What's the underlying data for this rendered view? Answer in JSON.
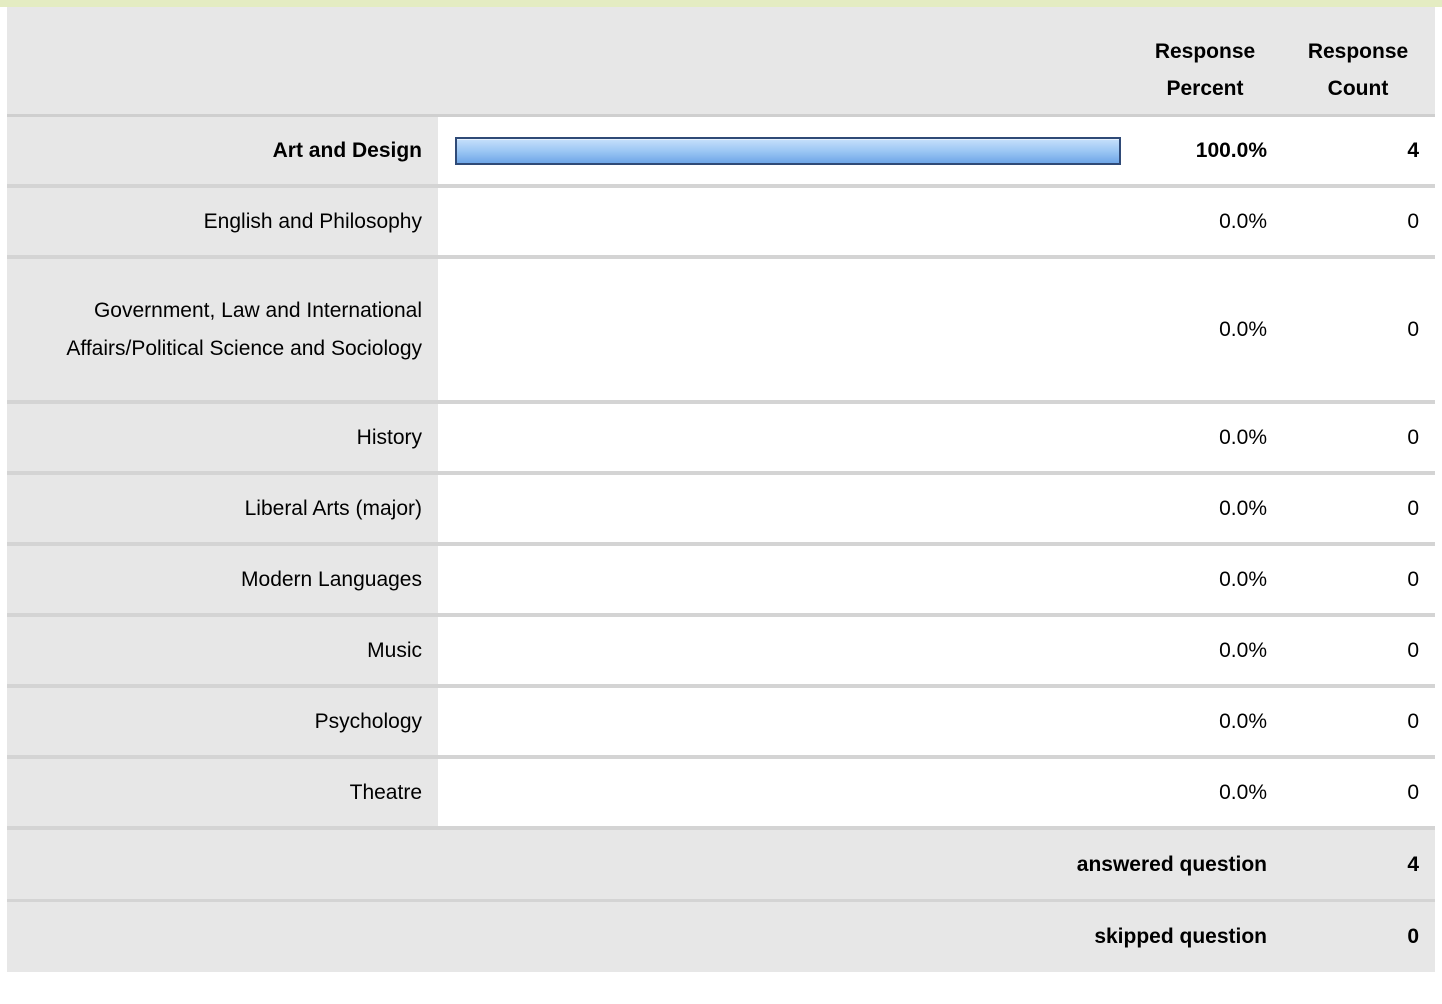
{
  "table": {
    "headers": {
      "response_percent": "Response\nPercent",
      "response_count": "Response\nCount"
    },
    "rows": [
      {
        "label": "Art and Design",
        "percent": "100.0%",
        "count": "4",
        "fraction": 1.0,
        "highlight": true
      },
      {
        "label": "English and Philosophy",
        "percent": "0.0%",
        "count": "0",
        "fraction": 0.0,
        "highlight": false
      },
      {
        "label": "Government, Law and International Affairs/Political Science and Sociology",
        "percent": "0.0%",
        "count": "0",
        "fraction": 0.0,
        "highlight": false
      },
      {
        "label": "History",
        "percent": "0.0%",
        "count": "0",
        "fraction": 0.0,
        "highlight": false
      },
      {
        "label": "Liberal Arts (major)",
        "percent": "0.0%",
        "count": "0",
        "fraction": 0.0,
        "highlight": false
      },
      {
        "label": "Modern Languages",
        "percent": "0.0%",
        "count": "0",
        "fraction": 0.0,
        "highlight": false
      },
      {
        "label": "Music",
        "percent": "0.0%",
        "count": "0",
        "fraction": 0.0,
        "highlight": false
      },
      {
        "label": "Psychology",
        "percent": "0.0%",
        "count": "0",
        "fraction": 0.0,
        "highlight": false
      },
      {
        "label": "Theatre",
        "percent": "0.0%",
        "count": "0",
        "fraction": 0.0,
        "highlight": false
      }
    ],
    "summary": {
      "answered_label": "answered question",
      "answered_value": "4",
      "skipped_label": "skipped question",
      "skipped_value": "0"
    }
  },
  "colors": {
    "bar_border": "#2f4a77",
    "bar_fill": "#9cc7f4",
    "label_bg": "#e7e7e7",
    "top_border": "#e4ecc2"
  }
}
